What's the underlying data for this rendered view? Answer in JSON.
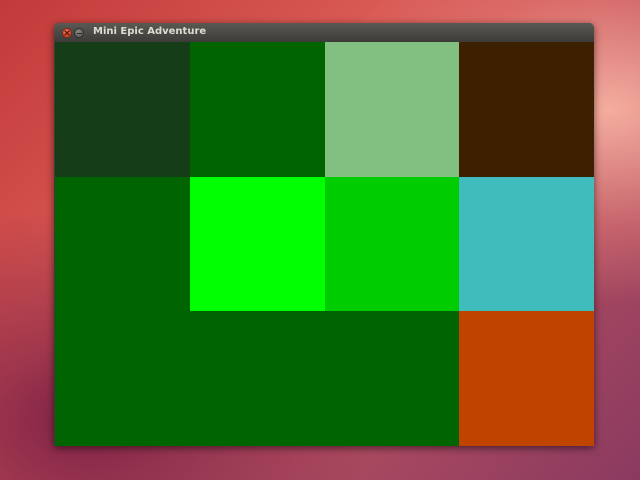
{
  "window": {
    "title": "Mini Epic Adventure"
  },
  "icons": {
    "close": "close-icon",
    "minimize": "minimize-icon"
  },
  "game": {
    "columns": 4,
    "rows": 3,
    "tiles": [
      [
        "#153d18",
        "#006400",
        "#82c082",
        "#3c2000"
      ],
      [
        "#006400",
        "#00ff00",
        "#00cd00",
        "#40bcbc"
      ],
      [
        "#006400",
        "#006400",
        "#006400",
        "#c04400"
      ]
    ]
  }
}
